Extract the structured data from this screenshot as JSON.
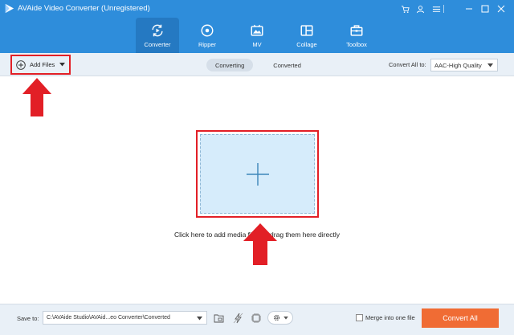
{
  "app": {
    "title": "AVAide Video Converter (Unregistered)",
    "icons": [
      "cart-icon",
      "account-icon",
      "menu-icon",
      "minimize-icon",
      "maximize-icon",
      "close-icon"
    ]
  },
  "nav": {
    "tabs": [
      {
        "label": "Converter",
        "icon": "converter-icon",
        "active": true
      },
      {
        "label": "Ripper",
        "icon": "ripper-icon",
        "active": false
      },
      {
        "label": "MV",
        "icon": "mv-icon",
        "active": false
      },
      {
        "label": "Collage",
        "icon": "collage-icon",
        "active": false
      },
      {
        "label": "Toolbox",
        "icon": "toolbox-icon",
        "active": false
      }
    ]
  },
  "toolbar": {
    "add_files_label": "Add Files",
    "subtabs": [
      {
        "label": "Converting",
        "active": true
      },
      {
        "label": "Converted",
        "active": false
      }
    ],
    "convert_all_label": "Convert All to:",
    "convert_all_value": "AAC-High Quality"
  },
  "main": {
    "hint": "Click here to add media files or drag them here directly"
  },
  "footer": {
    "save_to_label": "Save to:",
    "save_to_path": "C:\\AVAide Studio\\AVAid...eo Converter\\Converted",
    "merge_label": "Merge into one file",
    "merge_checked": false,
    "convert_all_button": "Convert All"
  },
  "colors": {
    "header_blue": "#2e8ddb",
    "active_tab_blue": "#2579c2",
    "highlight_red": "#e21f26",
    "drop_area_fill": "#d6ecfb",
    "convert_button": "#f06c34"
  }
}
